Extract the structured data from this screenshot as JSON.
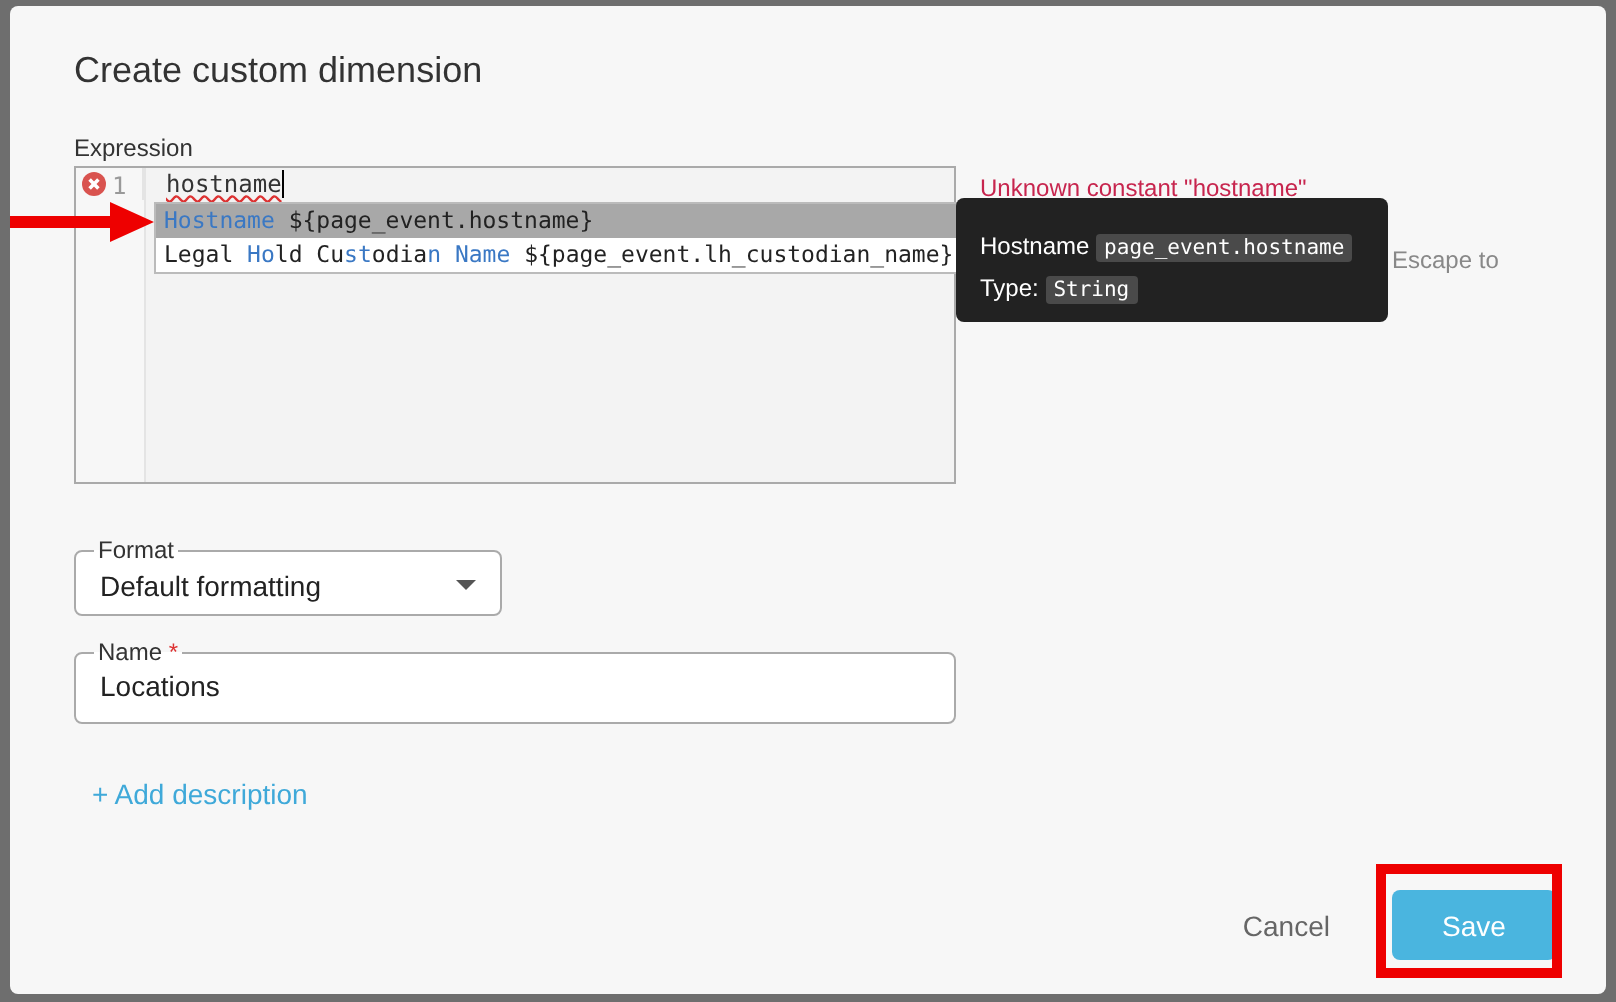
{
  "dialog": {
    "title": "Create custom dimension"
  },
  "expression": {
    "label": "Expression",
    "lines": [
      {
        "number": "1",
        "text": "hostname",
        "error": true
      }
    ],
    "error_message": "Unknown constant \"hostname\"",
    "hint_fragment": "Escape to",
    "suggestions": [
      {
        "selected": true,
        "parts": [
          {
            "text": "Hostname",
            "match": true
          },
          {
            "text": " ${page_event.hostname}",
            "match": false
          }
        ]
      },
      {
        "selected": false,
        "parts": [
          {
            "text": "Legal ",
            "match": false
          },
          {
            "text": "Ho",
            "match": true
          },
          {
            "text": "ld Cu",
            "match": false
          },
          {
            "text": "st",
            "match": true
          },
          {
            "text": "odia",
            "match": false
          },
          {
            "text": "n Name",
            "match": true
          },
          {
            "text": " ${page_event.lh_custodian_name}",
            "match": false
          }
        ]
      }
    ],
    "tooltip": {
      "name": "Hostname",
      "code": "page_event.hostname",
      "type_label": "Type:",
      "type": "String"
    }
  },
  "format": {
    "label": "Format",
    "value": "Default formatting"
  },
  "name_field": {
    "label": "Name",
    "required_mark": "*",
    "value": "Locations"
  },
  "add_description": "+ Add description",
  "buttons": {
    "cancel": "Cancel",
    "save": "Save"
  }
}
